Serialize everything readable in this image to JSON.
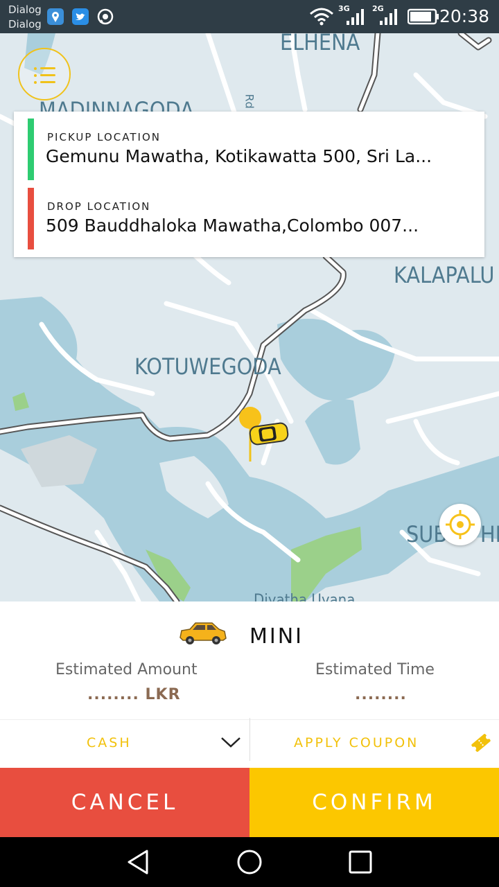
{
  "status_bar": {
    "carrier_1": "Dialog",
    "carrier_2": "Dialog",
    "network_1": "3G",
    "network_2": "2G",
    "time": "20:38",
    "icons": [
      "location-app-icon",
      "twitter-icon",
      "whatsapp-icon",
      "wifi-icon",
      "signal-icon",
      "battery-icon"
    ]
  },
  "map": {
    "labels": {
      "elhena": "ELHENA",
      "madinnagoda": "MADINNAGODA",
      "kalapaluwa": "KALAPALU",
      "kotuwegoda": "KOTUWEGODA",
      "subodhi": "SUB",
      "subodhi_tail": "HI",
      "road_rd": "Rd",
      "diyatha": "Diyatha Uyana"
    }
  },
  "location_card": {
    "pickup_title": "PICKUP LOCATION",
    "pickup_value": "Gemunu Mawatha, Kotikawatta 500, Sri La...",
    "drop_title": "DROP LOCATION",
    "drop_value": "509 Bauddhaloka Mawatha,Colombo 007..."
  },
  "vehicle": {
    "name": "MINI",
    "estimated_amount_label": "Estimated Amount",
    "estimated_amount_value": "........ LKR",
    "estimated_time_label": "Estimated Time",
    "estimated_time_value": "........"
  },
  "options": {
    "payment": "CASH",
    "coupon": "APPLY COUPON"
  },
  "actions": {
    "cancel": "CANCEL",
    "confirm": "CONFIRM"
  },
  "colors": {
    "accent": "#FCC700",
    "cancel": "#E84E3F",
    "pickup": "#2ECC71",
    "drop": "#E84E3F",
    "water": "#A9CEDC",
    "land": "#DFE9EE"
  }
}
